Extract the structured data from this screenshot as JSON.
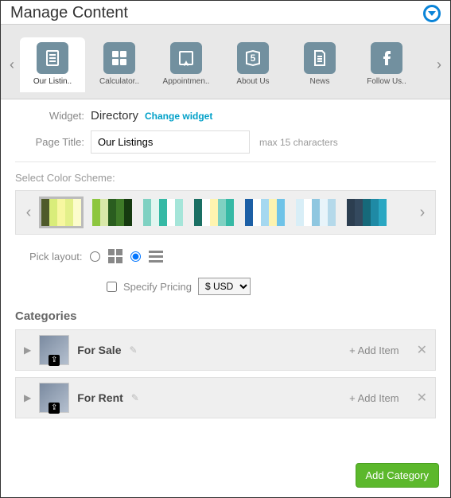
{
  "header": {
    "title": "Manage Content"
  },
  "tabs": {
    "items": [
      {
        "label": "Our Listin.."
      },
      {
        "label": "Calculator.."
      },
      {
        "label": "Appointmen.."
      },
      {
        "label": "About Us"
      },
      {
        "label": "News"
      },
      {
        "label": "Follow Us.."
      }
    ]
  },
  "form": {
    "widget_label": "Widget:",
    "widget_value": "Directory",
    "change_link": "Change widget",
    "page_title_label": "Page Title:",
    "page_title_value": "Our Listings",
    "page_title_hint": "max 15 characters"
  },
  "color_section": {
    "label": "Select Color Scheme:",
    "schemes": [
      [
        "#4f5a2a",
        "#d9ed7a",
        "#f7f7a0",
        "#e3f08a",
        "#fcfccc"
      ],
      [
        "#8dc63f",
        "#d9e8a9",
        "#2a5d1f",
        "#3f7a28",
        "#163a10"
      ],
      [
        "#7fd1c2",
        "#e2f5f0",
        "#36b9a5",
        "#ffffff",
        "#a5e5d9"
      ],
      [
        "#1a6f63",
        "#ffffff",
        "#fff4b0",
        "#7fd1c2",
        "#36b9a5"
      ],
      [
        "#1c5fa5",
        "#ffffff",
        "#a5d8f0",
        "#fdf3b0",
        "#6fc3e8"
      ],
      [
        "#d8eef7",
        "#ffffff",
        "#8fc7e0",
        "#e8f4fa",
        "#b5d9ea"
      ],
      [
        "#2c3e50",
        "#34495e",
        "#16697a",
        "#1f8aa5",
        "#2aa7c2"
      ]
    ]
  },
  "layout": {
    "label": "Pick layout:",
    "pricing_label": "Specify Pricing",
    "currency": "$ USD"
  },
  "categories": {
    "heading": "Categories",
    "add_item_label": "+ Add Item",
    "items": [
      {
        "name": "For Sale"
      },
      {
        "name": "For Rent"
      }
    ],
    "add_button": "Add Category"
  }
}
